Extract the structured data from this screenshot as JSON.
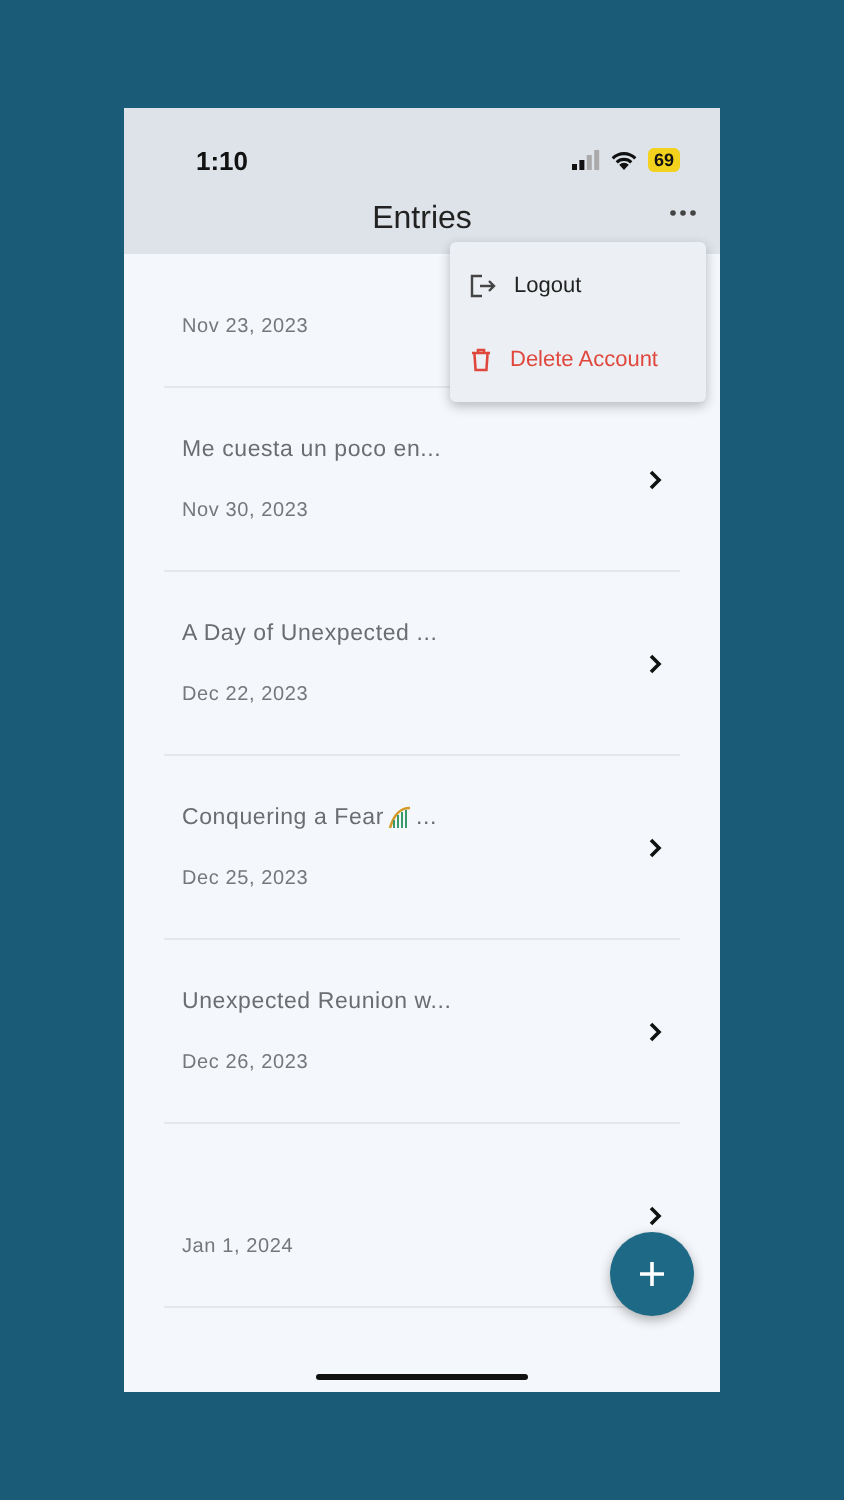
{
  "status_bar": {
    "time": "1:10",
    "battery": "69"
  },
  "header": {
    "title": "Entries"
  },
  "menu": {
    "items": [
      {
        "label": "Logout",
        "kind": "logout"
      },
      {
        "label": "Delete Account",
        "kind": "delete"
      }
    ]
  },
  "entries": [
    {
      "date": "Nov 23, 2023",
      "kind": "covered"
    },
    {
      "title": "Me cuesta un poco en...",
      "date": "Nov 30, 2023",
      "kind": "plain"
    },
    {
      "title": "A Day of Unexpected ...",
      "date": "Dec 22, 2023",
      "kind": "plain"
    },
    {
      "title": "Conquering a Fear",
      "trail": "...",
      "date": "Dec 25, 2023",
      "kind": "emoji"
    },
    {
      "title": "Unexpected Reunion w...",
      "date": "Dec 26, 2023",
      "kind": "plain"
    },
    {
      "date": "Jan 1, 2024"
    }
  ]
}
